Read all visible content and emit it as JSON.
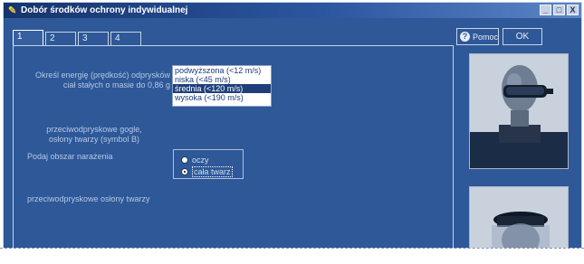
{
  "window": {
    "title": "Dobór środków ochrony indywidualnej",
    "controls": [
      "_",
      "□",
      "X"
    ]
  },
  "tabs": [
    "1",
    "2",
    "3",
    "4"
  ],
  "question1": "Określ energię (prędkość) odprysków ciał stałych o masie do 0,86 g",
  "listbox": {
    "items": [
      "podwyższona (<12 m/s)",
      "niska (<45 m/s)",
      "średnia (<120 m/s)",
      "wysoka (<190 m/s)"
    ],
    "selected_index": 2
  },
  "result1": "przeciwodpryskowe gogle, osłony twarzy (symbol B)",
  "question2": "Podaj obszar narażenia",
  "radio": {
    "options": [
      "oczy",
      "cała twarz"
    ],
    "selected_index": 1
  },
  "result2": "przeciwodpryskowe osłony twarzy",
  "buttons": {
    "help": "Pomoc",
    "ok": "OK"
  },
  "icons": {
    "help": "question-icon",
    "title": "tools-icon"
  },
  "colors": {
    "background": "#2e5897",
    "selection": "#1f3f7a"
  }
}
